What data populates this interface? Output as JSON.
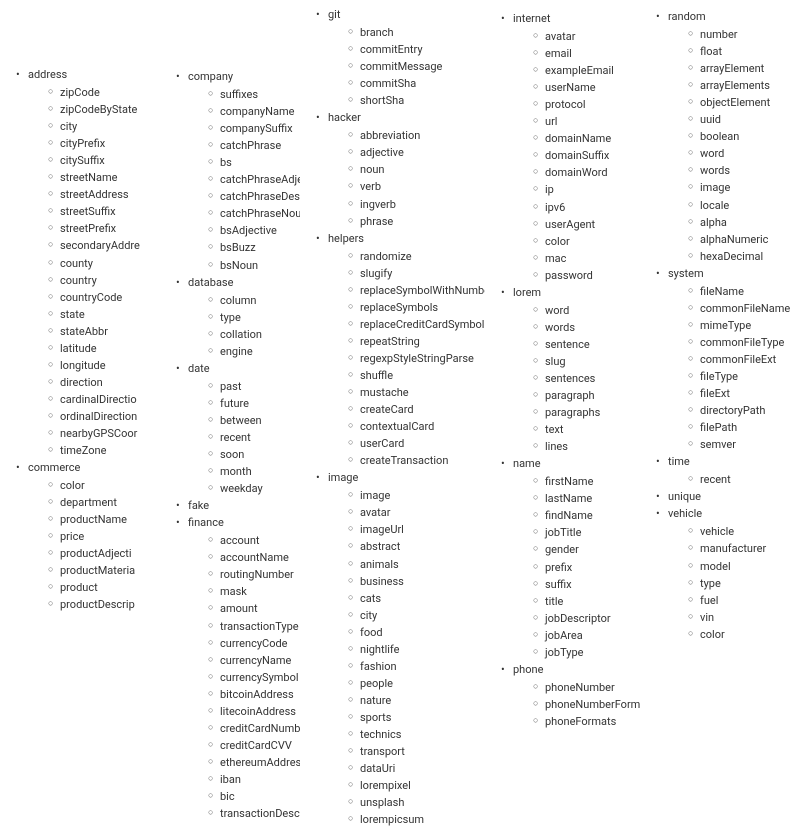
{
  "columns": [
    {
      "categories": [
        {
          "name": "address",
          "items": [
            "zipCode",
            "zipCodeByState",
            "city",
            "cityPrefix",
            "citySuffix",
            "streetName",
            "streetAddress",
            "streetSuffix",
            "streetPrefix",
            "secondaryAddre",
            "county",
            "country",
            "countryCode",
            "state",
            "stateAbbr",
            "latitude",
            "longitude",
            "direction",
            "cardinalDirectio",
            "ordinalDirection",
            "nearbyGPSCoor",
            "timeZone"
          ]
        },
        {
          "name": "commerce",
          "items": [
            "color",
            "department",
            "productName",
            "price",
            "productAdjecti",
            "productMateria",
            "product",
            "productDescrip"
          ]
        }
      ]
    },
    {
      "categories": [
        {
          "name": "company",
          "items": [
            "suffixes",
            "companyName",
            "companySuffix",
            "catchPhrase",
            "bs",
            "catchPhraseAdjective",
            "catchPhraseDescriptor",
            "catchPhraseNoun",
            "bsAdjective",
            "bsBuzz",
            "bsNoun"
          ]
        },
        {
          "name": "database",
          "items": [
            "column",
            "type",
            "collation",
            "engine"
          ]
        },
        {
          "name": "date",
          "items": [
            "past",
            "future",
            "between",
            "recent",
            "soon",
            "month",
            "weekday"
          ]
        },
        {
          "name": "fake",
          "items": []
        },
        {
          "name": "finance",
          "items": [
            "account",
            "accountName",
            "routingNumber",
            "mask",
            "amount",
            "transactionType",
            "currencyCode",
            "currencyName",
            "currencySymbol",
            "bitcoinAddress",
            "litecoinAddress",
            "creditCardNumber",
            "creditCardCVV",
            "ethereumAddress",
            "iban",
            "bic",
            "transactionDescription"
          ]
        }
      ]
    },
    {
      "categories": [
        {
          "name": "git",
          "items": [
            "branch",
            "commitEntry",
            "commitMessage",
            "commitSha",
            "shortSha"
          ]
        },
        {
          "name": "hacker",
          "items": [
            "abbreviation",
            "adjective",
            "noun",
            "verb",
            "ingverb",
            "phrase"
          ]
        },
        {
          "name": "helpers",
          "items": [
            "randomize",
            "slugify",
            "replaceSymbolWithNumber",
            "replaceSymbols",
            "replaceCreditCardSymbols",
            "repeatString",
            "regexpStyleStringParse",
            "shuffle",
            "mustache",
            "createCard",
            "contextualCard",
            "userCard",
            "createTransaction"
          ]
        },
        {
          "name": "image",
          "items": [
            "image",
            "avatar",
            "imageUrl",
            "abstract",
            "animals",
            "business",
            "cats",
            "city",
            "food",
            "nightlife",
            "fashion",
            "people",
            "nature",
            "sports",
            "technics",
            "transport",
            "dataUri",
            "lorempixel",
            "unsplash",
            "lorempicsum"
          ]
        }
      ]
    },
    {
      "categories": [
        {
          "name": "internet",
          "items": [
            "avatar",
            "email",
            "exampleEmail",
            "userName",
            "protocol",
            "url",
            "domainName",
            "domainSuffix",
            "domainWord",
            "ip",
            "ipv6",
            "userAgent",
            "color",
            "mac",
            "password"
          ]
        },
        {
          "name": "lorem",
          "items": [
            "word",
            "words",
            "sentence",
            "slug",
            "sentences",
            "paragraph",
            "paragraphs",
            "text",
            "lines"
          ]
        },
        {
          "name": "name",
          "items": [
            "firstName",
            "lastName",
            "findName",
            "jobTitle",
            "gender",
            "prefix",
            "suffix",
            "title",
            "jobDescriptor",
            "jobArea",
            "jobType"
          ]
        },
        {
          "name": "phone",
          "items": [
            "phoneNumber",
            "phoneNumberFormat",
            "phoneFormats"
          ]
        }
      ]
    },
    {
      "categories": [
        {
          "name": "random",
          "items": [
            "number",
            "float",
            "arrayElement",
            "arrayElements",
            "objectElement",
            "uuid",
            "boolean",
            "word",
            "words",
            "image",
            "locale",
            "alpha",
            "alphaNumeric",
            "hexaDecimal"
          ]
        },
        {
          "name": "system",
          "items": [
            "fileName",
            "commonFileName",
            "mimeType",
            "commonFileType",
            "commonFileExt",
            "fileType",
            "fileExt",
            "directoryPath",
            "filePath",
            "semver"
          ]
        },
        {
          "name": "time",
          "items": [
            "recent"
          ]
        },
        {
          "name": "unique",
          "items": []
        },
        {
          "name": "vehicle",
          "items": [
            "vehicle",
            "manufacturer",
            "model",
            "type",
            "fuel",
            "vin",
            "color"
          ]
        }
      ]
    }
  ]
}
